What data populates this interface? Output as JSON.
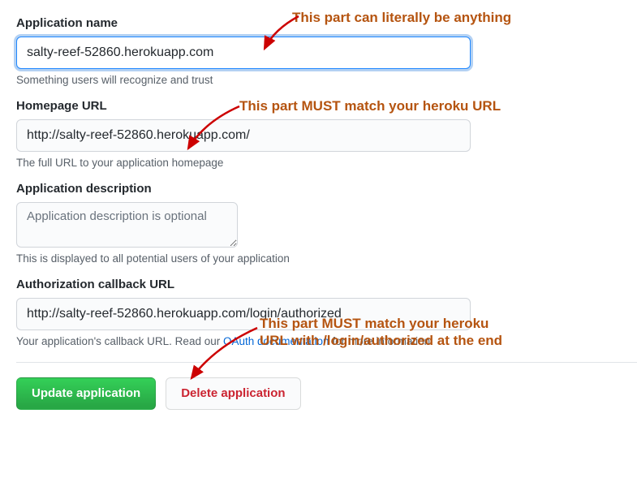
{
  "form": {
    "app_name": {
      "label": "Application name",
      "value": "salty-reef-52860.herokuapp.com",
      "help": "Something users will recognize and trust"
    },
    "homepage_url": {
      "label": "Homepage URL",
      "value": "http://salty-reef-52860.herokuapp.com/",
      "help": "The full URL to your application homepage"
    },
    "description": {
      "label": "Application description",
      "placeholder": "Application description is optional",
      "help": "This is displayed to all potential users of your application"
    },
    "callback_url": {
      "label": "Authorization callback URL",
      "value": "http://salty-reef-52860.herokuapp.com/login/authorized",
      "help_pre": "Your application's callback URL. Read our ",
      "help_link": "OAuth documentation",
      "help_post": " for more information."
    }
  },
  "buttons": {
    "update": "Update application",
    "delete": "Delete application"
  },
  "annotations": {
    "a1": "This part can literally be anything",
    "a2": "This part MUST match your heroku URL",
    "a3": "This part MUST match your heroku\nURL with /login/authorized at the end"
  },
  "colors": {
    "annotation": "#b55410",
    "primary_button": "#2ea44f",
    "danger_text": "#cb2431",
    "link": "#0366d6"
  }
}
